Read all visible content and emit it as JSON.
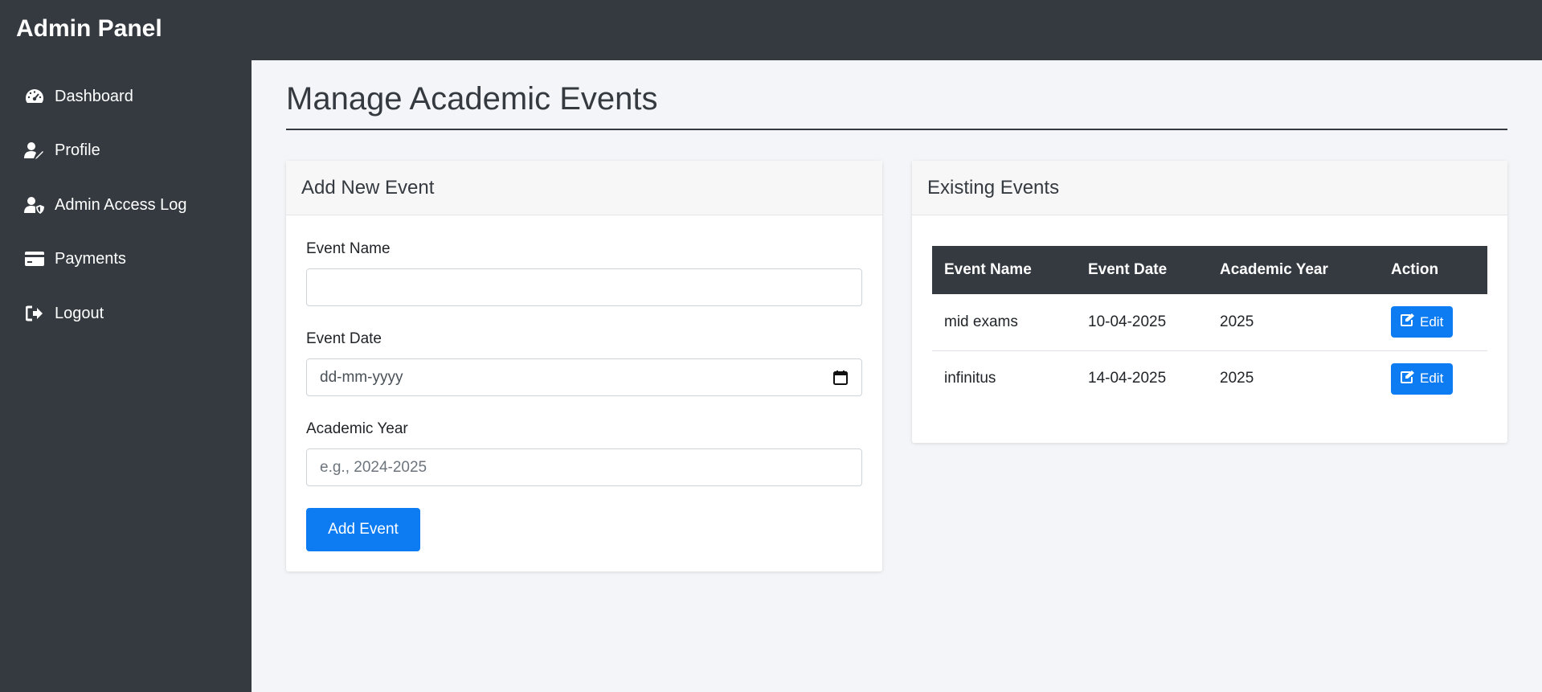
{
  "app": {
    "brand": "Admin Panel"
  },
  "sidebar": {
    "items": [
      {
        "label": "Dashboard",
        "icon": "gauge-icon"
      },
      {
        "label": "Profile",
        "icon": "user-edit-icon"
      },
      {
        "label": "Admin Access Log",
        "icon": "user-shield-icon"
      },
      {
        "label": "Payments",
        "icon": "credit-card-icon"
      },
      {
        "label": "Logout",
        "icon": "logout-icon"
      }
    ]
  },
  "main": {
    "title": "Manage Academic Events",
    "add_form": {
      "header": "Add New Event",
      "event_name_label": "Event Name",
      "event_name_value": "",
      "event_date_label": "Event Date",
      "event_date_placeholder": "dd-mm-yyyy",
      "academic_year_label": "Academic Year",
      "academic_year_placeholder": "e.g., 2024-2025",
      "submit_label": "Add Event"
    },
    "events": {
      "header": "Existing Events",
      "columns": [
        "Event Name",
        "Event Date",
        "Academic Year",
        "Action"
      ],
      "rows": [
        {
          "name": "mid exams",
          "date": "10-04-2025",
          "year": "2025",
          "action": "Edit"
        },
        {
          "name": "infinitus",
          "date": "14-04-2025",
          "year": "2025",
          "action": "Edit"
        }
      ]
    }
  },
  "colors": {
    "sidebar_bg": "#343a40",
    "page_bg": "#f4f5f8",
    "primary": "#0d7cf2"
  }
}
